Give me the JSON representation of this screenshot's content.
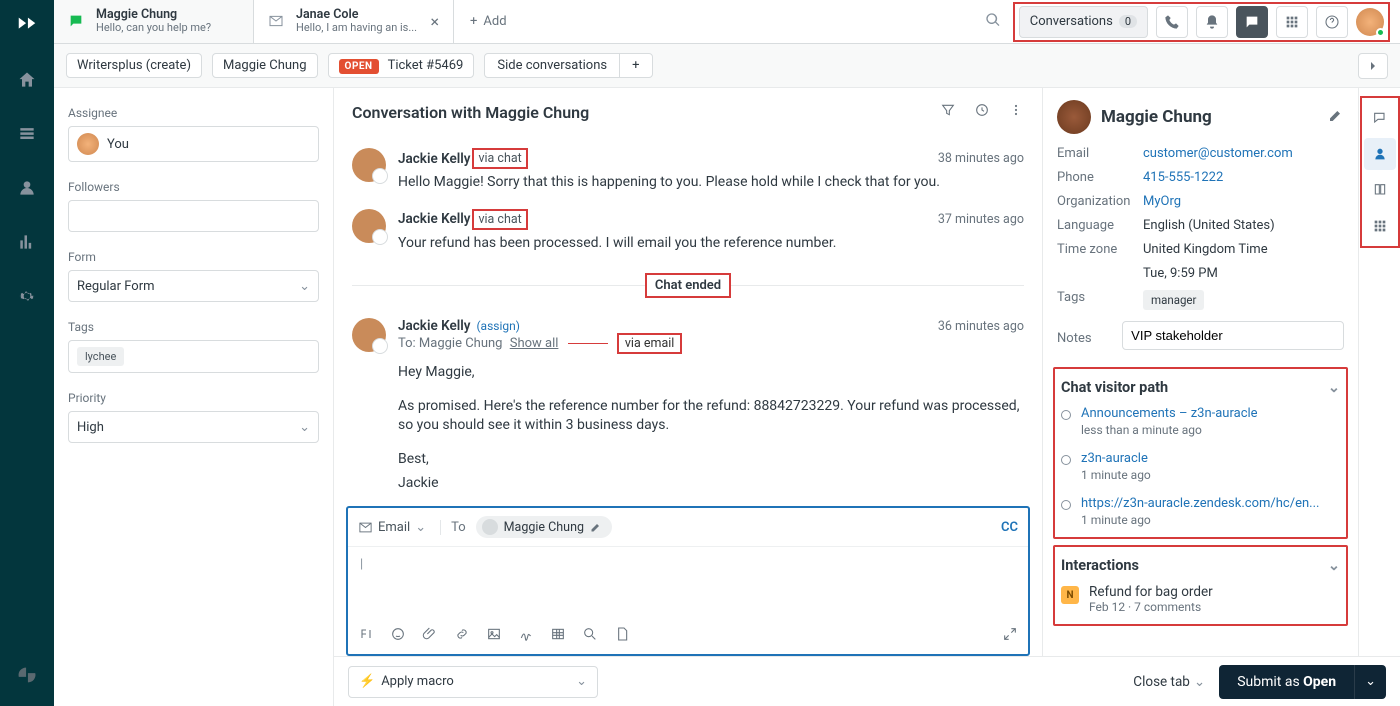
{
  "tabs": [
    {
      "title": "Maggie Chung",
      "sub": "Hello, can you help me?",
      "channel": "chat"
    },
    {
      "title": "Janae Cole",
      "sub": "Hello, I am having an is...",
      "channel": "email"
    }
  ],
  "add_tab": "Add",
  "top_right": {
    "conversations_label": "Conversations",
    "conversations_count": "0"
  },
  "sec_bar": {
    "crumb1": "Writersplus (create)",
    "crumb2": "Maggie Chung",
    "open_badge": "OPEN",
    "ticket_label": "Ticket #5469",
    "side_conv": "Side conversations"
  },
  "left": {
    "assignee_label": "Assignee",
    "assignee_value": "You",
    "followers_label": "Followers",
    "form_label": "Form",
    "form_value": "Regular Form",
    "tags_label": "Tags",
    "tags_chip": "lychee",
    "priority_label": "Priority",
    "priority_value": "High"
  },
  "main": {
    "title": "Conversation with Maggie Chung",
    "msgs": [
      {
        "author": "Jackie Kelly",
        "via": "via chat",
        "time": "38 minutes ago",
        "text": "Hello Maggie! Sorry that this is happening to you. Please hold while I check that for you."
      },
      {
        "author": "Jackie Kelly",
        "via": "via chat",
        "time": "37 minutes ago",
        "text": "Your refund has been processed. I will email you the reference number."
      }
    ],
    "divider": "Chat ended",
    "email": {
      "author": "Jackie Kelly",
      "assign": "(assign)",
      "time": "36 minutes ago",
      "to_prefix": "To: Maggie Chung",
      "show_all": "Show all",
      "via": "via email",
      "greeting": "Hey Maggie,",
      "body": "As promised. Here's the reference number for the refund: 88842723229. Your refund was processed, so you should see it within 3 business days.",
      "sign1": "Best,",
      "sign2": "Jackie"
    },
    "composer": {
      "channel": "Email",
      "to_label": "To",
      "recipient": "Maggie Chung",
      "cc": "CC"
    }
  },
  "right": {
    "name": "Maggie Chung",
    "rows": {
      "email_k": "Email",
      "email_v": "customer@customer.com",
      "phone_k": "Phone",
      "phone_v": "415-555-1222",
      "org_k": "Organization",
      "org_v": "MyOrg",
      "lang_k": "Language",
      "lang_v": "English (United States)",
      "tz_k": "Time zone",
      "tz_v": "United Kingdom Time",
      "tz_v2": "Tue, 9:59 PM",
      "tags_k": "Tags",
      "tags_v": "manager",
      "notes_k": "Notes",
      "notes_v": "VIP stakeholder"
    },
    "visitor_path": {
      "title": "Chat visitor path",
      "items": [
        {
          "link": "Announcements – z3n-auracle",
          "meta": "less than a minute ago"
        },
        {
          "link": "z3n-auracle",
          "meta": "1 minute ago"
        },
        {
          "link": "https://z3n-auracle.zendesk.com/hc/en...",
          "meta": "1 minute ago"
        }
      ]
    },
    "interactions": {
      "title": "Interactions",
      "item_title": "Refund for bag order",
      "item_meta": "Feb 12 · 7 comments"
    }
  },
  "footer": {
    "macro": "Apply macro",
    "close_tab": "Close tab",
    "submit_pre": "Submit as ",
    "submit_status": "Open"
  }
}
